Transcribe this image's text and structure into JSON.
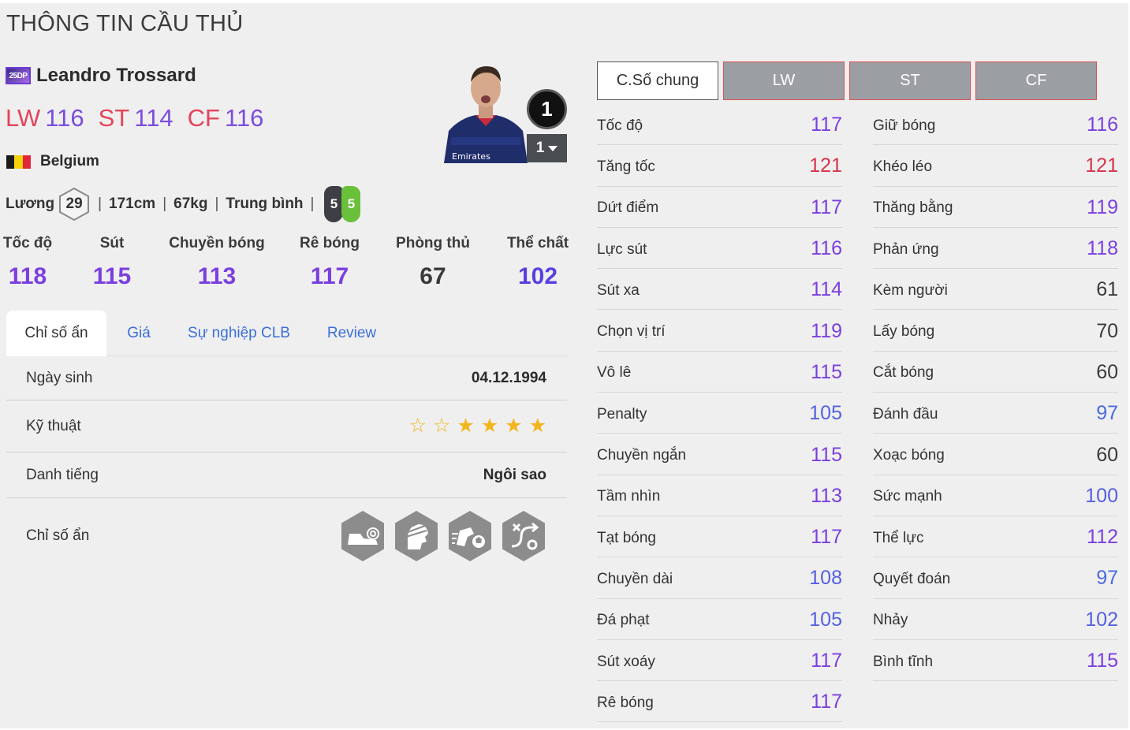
{
  "page": {
    "title": "THÔNG TIN CẦU THỦ"
  },
  "player": {
    "season_badge": "25DP",
    "name": "Leandro Trossard",
    "positions": [
      {
        "label": "LW",
        "value": "116"
      },
      {
        "label": "ST",
        "value": "114"
      },
      {
        "label": "CF",
        "value": "116"
      }
    ],
    "nation": "Belgium",
    "salary_label": "Lương",
    "salary": "29",
    "height": "171cm",
    "weight": "67kg",
    "body_type": "Trung bình",
    "left_foot": "5",
    "right_foot": "5",
    "level": "1",
    "level_select": "1"
  },
  "summary": [
    {
      "label": "Tốc độ",
      "value": "118",
      "color": "#7b3fe0"
    },
    {
      "label": "Sút",
      "value": "115",
      "color": "#7b3fe0"
    },
    {
      "label": "Chuyền bóng",
      "value": "113",
      "color": "#7b3fe0"
    },
    {
      "label": "Rê bóng",
      "value": "117",
      "color": "#7b3fe0"
    },
    {
      "label": "Phòng thủ",
      "value": "67",
      "color": "#3a3a3a"
    },
    {
      "label": "Thể chất",
      "value": "102",
      "color": "#5a3fe0"
    }
  ],
  "tabs": [
    "Chỉ số ẩn",
    "Giá",
    "Sự nghiệp CLB",
    "Review"
  ],
  "info": {
    "birth_label": "Ngày sinh",
    "birth_value": "04.12.1994",
    "skill_label": "Kỹ thuật",
    "skill_stars": 4,
    "skill_max": 6,
    "fame_label": "Danh tiếng",
    "fame_value": "Ngôi sao",
    "traits_label": "Chỉ số ẩn",
    "trait_icons": [
      "boot-trait-icon",
      "visor-head-trait-icon",
      "fast-dribble-trait-icon",
      "playmaker-path-trait-icon"
    ]
  },
  "pos_tabs": [
    "C.Số chung",
    "LW",
    "ST",
    "CF"
  ],
  "stats_left": [
    {
      "name": "Tốc độ",
      "value": "117",
      "color": "#7b3fe0"
    },
    {
      "name": "Tăng tốc",
      "value": "121",
      "color": "#d6334a"
    },
    {
      "name": "Dứt điểm",
      "value": "117",
      "color": "#7b3fe0"
    },
    {
      "name": "Lực sút",
      "value": "116",
      "color": "#7b3fe0"
    },
    {
      "name": "Sút xa",
      "value": "114",
      "color": "#7b3fe0"
    },
    {
      "name": "Chọn vị trí",
      "value": "119",
      "color": "#7b3fe0"
    },
    {
      "name": "Vô lê",
      "value": "115",
      "color": "#7b3fe0"
    },
    {
      "name": "Penalty",
      "value": "105",
      "color": "#5560e0"
    },
    {
      "name": "Chuyền ngắn",
      "value": "115",
      "color": "#7b3fe0"
    },
    {
      "name": "Tầm nhìn",
      "value": "113",
      "color": "#7b3fe0"
    },
    {
      "name": "Tạt bóng",
      "value": "117",
      "color": "#7b3fe0"
    },
    {
      "name": "Chuyền dài",
      "value": "108",
      "color": "#5560e0"
    },
    {
      "name": "Đá phạt",
      "value": "105",
      "color": "#5560e0"
    },
    {
      "name": "Sút xoáy",
      "value": "117",
      "color": "#7b3fe0"
    },
    {
      "name": "Rê bóng",
      "value": "117",
      "color": "#7b3fe0"
    }
  ],
  "stats_right": [
    {
      "name": "Giữ bóng",
      "value": "116",
      "color": "#7b3fe0"
    },
    {
      "name": "Khéo léo",
      "value": "121",
      "color": "#d6334a"
    },
    {
      "name": "Thăng bằng",
      "value": "119",
      "color": "#7b3fe0"
    },
    {
      "name": "Phản ứng",
      "value": "118",
      "color": "#7b3fe0"
    },
    {
      "name": "Kèm người",
      "value": "61",
      "color": "#3a3a3a"
    },
    {
      "name": "Lấy bóng",
      "value": "70",
      "color": "#3a3a3a"
    },
    {
      "name": "Cắt bóng",
      "value": "60",
      "color": "#3a3a3a"
    },
    {
      "name": "Đánh đầu",
      "value": "97",
      "color": "#4a6ae0"
    },
    {
      "name": "Xoạc bóng",
      "value": "60",
      "color": "#3a3a3a"
    },
    {
      "name": "Sức mạnh",
      "value": "100",
      "color": "#5560e0"
    },
    {
      "name": "Thể lực",
      "value": "112",
      "color": "#7b3fe0"
    },
    {
      "name": "Quyết đoán",
      "value": "97",
      "color": "#4a6ae0"
    },
    {
      "name": "Nhảy",
      "value": "102",
      "color": "#5560e0"
    },
    {
      "name": "Bình tĩnh",
      "value": "115",
      "color": "#7b3fe0"
    }
  ],
  "colors": {
    "flag_black": "#1a1a1a",
    "flag_yellow": "#f5d20c",
    "flag_red": "#e2263a",
    "star_filled": "#f2b51c"
  }
}
